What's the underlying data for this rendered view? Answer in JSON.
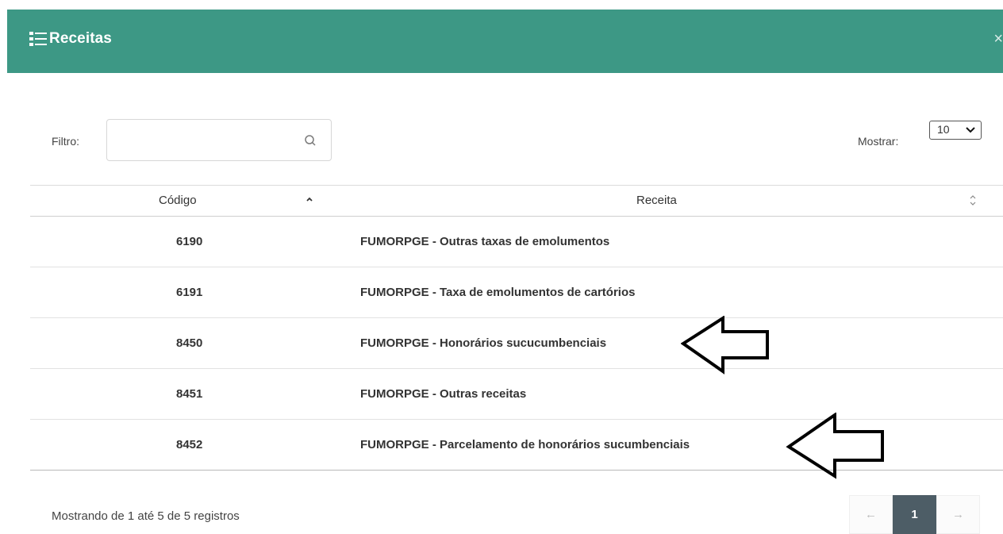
{
  "modal": {
    "title": "Receitas",
    "close_label": "×"
  },
  "filter": {
    "label": "Filtro:",
    "value": "",
    "placeholder": ""
  },
  "show": {
    "label": "Mostrar:",
    "selected": "10"
  },
  "table": {
    "headers": [
      "Código",
      "Receita"
    ],
    "rows": [
      {
        "code": "6190",
        "receita": "FUMORPGE - Outras taxas de emolumentos"
      },
      {
        "code": "6191",
        "receita": "FUMORPGE - Taxa de emolumentos de cartórios"
      },
      {
        "code": "8450",
        "receita": "FUMORPGE - Honorários sucucumbenciais"
      },
      {
        "code": "8451",
        "receita": "FUMORPGE - Outras receitas"
      },
      {
        "code": "8452",
        "receita": "FUMORPGE - Parcelamento de honorários sucumbenciais"
      }
    ]
  },
  "footer": {
    "info": "Mostrando de 1 até 5 de 5 registros",
    "prev": "←",
    "current_page": "1",
    "next": "→"
  },
  "colors": {
    "header_bg": "#3d9885",
    "pager_active": "#4d5d66"
  },
  "icons": [
    "list-icon",
    "close-icon",
    "search-icon",
    "chevron-down-icon",
    "sort-up-icon",
    "sort-both-icon",
    "left-arrow-annotation-icon"
  ]
}
